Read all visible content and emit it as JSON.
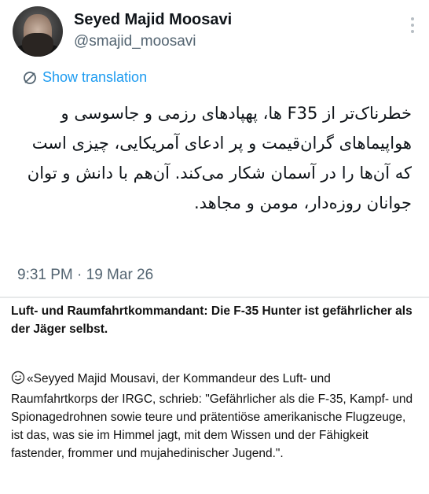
{
  "tweet": {
    "author_name": "Seyed Majid Moosavi",
    "author_handle": "@smajid_moosavi",
    "translate_label": "Show translation",
    "text": "خطرناک‌تر از F35 ها، پهپادهای رزمی و جاسوسی و هواپیماهای گران‌قیمت و پر ادعای آمریکایی، چیزی است که آن‌ها را در آسمان شکار می‌کند. آن‌هم با دانش و توان جوانان روزه‌دار، مومن و مجاهد.",
    "timestamp": "9:31 PM · 19 Mar 26",
    "icons": {
      "avatar": "profile-photo",
      "more": "more-vertical-icon",
      "translate": "globe-slash-icon"
    },
    "colors": {
      "link": "#1d9bf0",
      "muted": "#536471",
      "text": "#0f1419"
    }
  },
  "post": {
    "caption": "Luft- und Raumfahrtkommandant: Die F-35 Hunter ist gefährlicher als der Jäger selbst.",
    "body": "«Seyyed Majid Mousavi, der Kommandeur des Luft- und Raumfahrtkorps der IRGC, schrieb: \"Gefährlicher als die F-35, Kampf- und Spionagedrohnen sowie teure und prätentiöse amerikanische Flugzeuge, ist das, was sie im Himmel jagt, mit dem Wissen und der Fähigkeit fastender, frommer und mujahedinischer Jugend.\".",
    "icons": {
      "leading": "smiley-emoji-icon"
    }
  }
}
